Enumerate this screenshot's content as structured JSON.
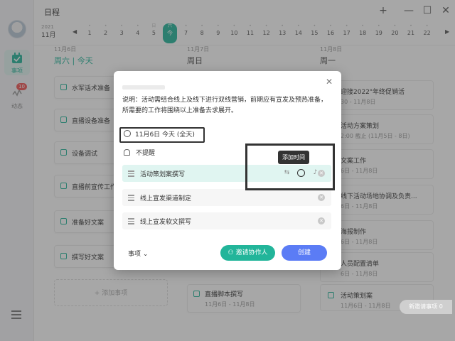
{
  "app": {
    "title": "日程",
    "window_buttons": [
      "+",
      "—",
      "☐",
      "✕"
    ]
  },
  "sidebar": {
    "items": [
      {
        "label": "事项",
        "badge": ""
      },
      {
        "label": "动态",
        "badge": "10"
      }
    ]
  },
  "datestrip": {
    "year": "2021",
    "month": "11月",
    "days": [
      {
        "dot": "•",
        "num": "1"
      },
      {
        "dot": "•",
        "num": "2"
      },
      {
        "dot": "•",
        "num": "3"
      },
      {
        "dot": "•",
        "num": "4"
      },
      {
        "dot": "日",
        "num": "5"
      },
      {
        "dot": "六",
        "num": "今"
      },
      {
        "dot": "•",
        "num": "7"
      },
      {
        "dot": "•",
        "num": "8"
      },
      {
        "dot": "•",
        "num": "9"
      },
      {
        "dot": "•",
        "num": "10"
      },
      {
        "dot": "•",
        "num": "11"
      },
      {
        "dot": "•",
        "num": "12"
      },
      {
        "dot": "•",
        "num": "13"
      },
      {
        "dot": "•",
        "num": "14"
      },
      {
        "dot": "•",
        "num": "15"
      },
      {
        "dot": "•",
        "num": "16"
      },
      {
        "dot": "•",
        "num": "17"
      },
      {
        "dot": "•",
        "num": "18"
      },
      {
        "dot": "•",
        "num": "19"
      },
      {
        "dot": "•",
        "num": "20"
      },
      {
        "dot": "•",
        "num": "21"
      },
      {
        "dot": "•",
        "num": "22"
      }
    ]
  },
  "columns": [
    {
      "date": "11月6日",
      "head": "周六 | 今天"
    },
    {
      "date": "11月7日",
      "head": "周日"
    },
    {
      "date": "11月8日",
      "head": "周一"
    }
  ],
  "col1_tasks": [
    "水军话术准备",
    "直播设备准备",
    "设备调试",
    "直播前宣传工作",
    "准备好文案",
    "撰写好文案"
  ],
  "add_task": "+ 添加事项",
  "col2_bottom": {
    "title": "直播脚本撰写",
    "sub": "11月6日 - 11月8日"
  },
  "col3_items": [
    {
      "title": "迎接2022\"年终促销活",
      "sub": "30 - 11月8日"
    },
    {
      "title": "活动方案策划",
      "sub": "2:00 截止 (11月5日 - 8日)"
    },
    {
      "title": "文案工作",
      "sub": "6日 - 11月8日"
    },
    {
      "title": "线下活动场地协调及负责...",
      "sub": "6日 - 11月8日"
    },
    {
      "title": "海报制作",
      "sub": "6日 - 11月8日"
    },
    {
      "title": "人员配置清单",
      "sub": "6日 - 11月8日"
    },
    {
      "title": "活动策划案",
      "sub": "11月6日 - 11月8日"
    }
  ],
  "dialog": {
    "description": "说明：活动需结合线上及线下进行双线营销，前期应有宣发及预热准备，所需要的工作将围绕以上准备去求展开。",
    "date": "11月6日 今天 (全天)",
    "remind": "不提醒",
    "subtasks": [
      "活动策划案撰写",
      "线上宣发渠道制定",
      "线上宣发软文撰写"
    ],
    "tooltip": "添加时间",
    "footer_label": "事项 ⌄",
    "invite": "邀请协作人",
    "create": "创建"
  },
  "pending": "新邀请事项 0",
  "colors": {
    "accent": "#22b59a",
    "create": "#5b7cf5",
    "badge": "#f05050"
  }
}
